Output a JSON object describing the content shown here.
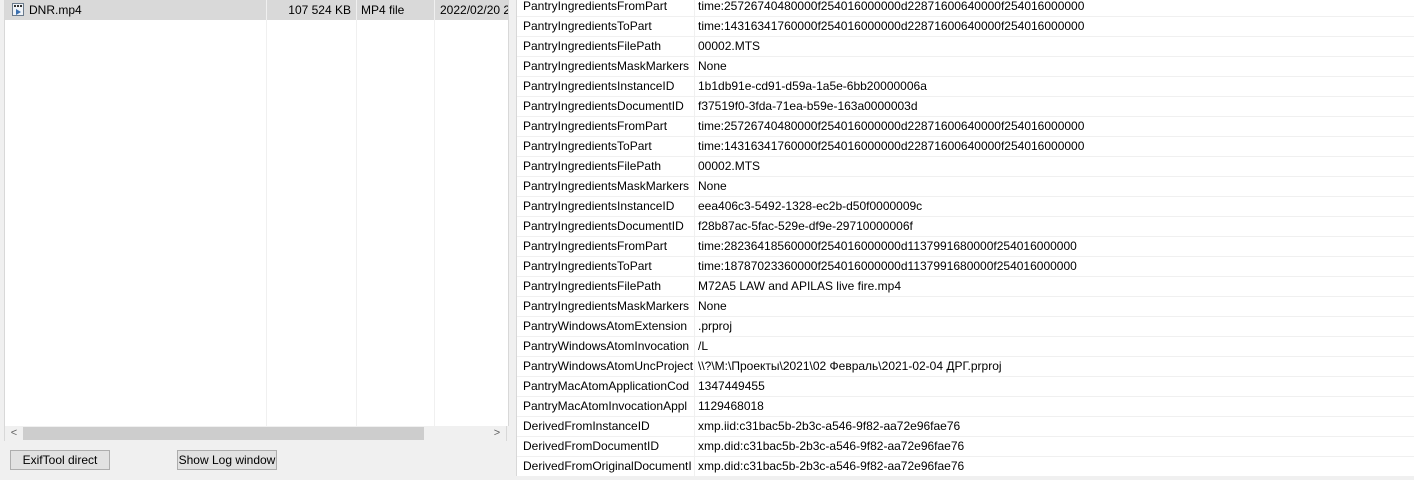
{
  "file_list": {
    "rows": [
      {
        "name": "DNR.mp4",
        "size": "107 524 KB",
        "type": "MP4 file",
        "date": "2022/02/20 2"
      }
    ]
  },
  "buttons": {
    "exiftool_direct": "ExifTool direct",
    "show_log_window": "Show Log window"
  },
  "scrollbar": {
    "left_arrow": "<",
    "right_arrow": ">"
  },
  "metadata": [
    {
      "tag": "PantryIngredientsFromPart",
      "value": "time:25726740480000f254016000000d22871600640000f254016000000"
    },
    {
      "tag": "PantryIngredientsToPart",
      "value": "time:14316341760000f254016000000d22871600640000f254016000000"
    },
    {
      "tag": "PantryIngredientsFilePath",
      "value": "00002.MTS"
    },
    {
      "tag": "PantryIngredientsMaskMarkers",
      "value": "None"
    },
    {
      "tag": "PantryIngredientsInstanceID",
      "value": "1b1db91e-cd91-d59a-1a5e-6bb20000006a"
    },
    {
      "tag": "PantryIngredientsDocumentID",
      "value": "f37519f0-3fda-71ea-b59e-163a0000003d"
    },
    {
      "tag": "PantryIngredientsFromPart",
      "value": "time:25726740480000f254016000000d22871600640000f254016000000"
    },
    {
      "tag": "PantryIngredientsToPart",
      "value": "time:14316341760000f254016000000d22871600640000f254016000000"
    },
    {
      "tag": "PantryIngredientsFilePath",
      "value": "00002.MTS"
    },
    {
      "tag": "PantryIngredientsMaskMarkers",
      "value": "None"
    },
    {
      "tag": "PantryIngredientsInstanceID",
      "value": "eea406c3-5492-1328-ec2b-d50f0000009c"
    },
    {
      "tag": "PantryIngredientsDocumentID",
      "value": "f28b87ac-5fac-529e-df9e-29710000006f"
    },
    {
      "tag": "PantryIngredientsFromPart",
      "value": "time:28236418560000f254016000000d1137991680000f254016000000"
    },
    {
      "tag": "PantryIngredientsToPart",
      "value": "time:18787023360000f254016000000d1137991680000f254016000000"
    },
    {
      "tag": "PantryIngredientsFilePath",
      "value": "M72A5 LAW and APILAS live fire.mp4"
    },
    {
      "tag": "PantryIngredientsMaskMarkers",
      "value": "None"
    },
    {
      "tag": "PantryWindowsAtomExtension",
      "value": ".prproj"
    },
    {
      "tag": "PantryWindowsAtomInvocation",
      "value": "/L"
    },
    {
      "tag": "PantryWindowsAtomUncProject",
      "value": "\\\\?\\M:\\Проекты\\2021\\02 Февраль\\2021-02-04 ДРГ.prproj"
    },
    {
      "tag": "PantryMacAtomApplicationCod",
      "value": "1347449455"
    },
    {
      "tag": "PantryMacAtomInvocationAppl",
      "value": "1129468018"
    },
    {
      "tag": "DerivedFromInstanceID",
      "value": "xmp.iid:c31bac5b-2b3c-a546-9f82-aa72e96fae76"
    },
    {
      "tag": "DerivedFromDocumentID",
      "value": "xmp.did:c31bac5b-2b3c-a546-9f82-aa72e96fae76"
    },
    {
      "tag": "DerivedFromOriginalDocumentI",
      "value": "xmp.did:c31bac5b-2b3c-a546-9f82-aa72e96fae76"
    }
  ]
}
